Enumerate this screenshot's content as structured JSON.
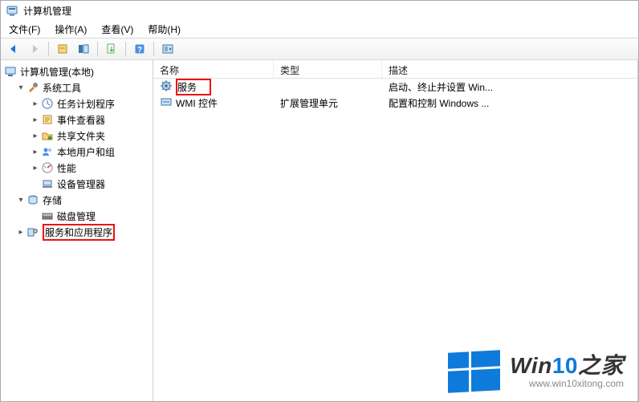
{
  "title": "计算机管理",
  "menus": {
    "file": "文件(F)",
    "action": "操作(A)",
    "view": "查看(V)",
    "help": "帮助(H)"
  },
  "tree": {
    "root": "计算机管理(本地)",
    "system_tools": "系统工具",
    "task_scheduler": "任务计划程序",
    "event_viewer": "事件查看器",
    "shared_folders": "共享文件夹",
    "local_users": "本地用户和组",
    "performance": "性能",
    "device_manager": "设备管理器",
    "storage": "存储",
    "disk_management": "磁盘管理",
    "services_apps": "服务和应用程序"
  },
  "list": {
    "headers": {
      "name": "名称",
      "type": "类型",
      "desc": "描述"
    },
    "rows": [
      {
        "name": "服务",
        "type": "",
        "desc": "启动、终止并设置 Win..."
      },
      {
        "name": "WMI 控件",
        "type": "扩展管理单元",
        "desc": "配置和控制 Windows ..."
      }
    ]
  },
  "watermark": {
    "brand_prefix": "Win",
    "brand_num": "10",
    "brand_suffix": "之家",
    "url": "www.win10xitong.com"
  }
}
